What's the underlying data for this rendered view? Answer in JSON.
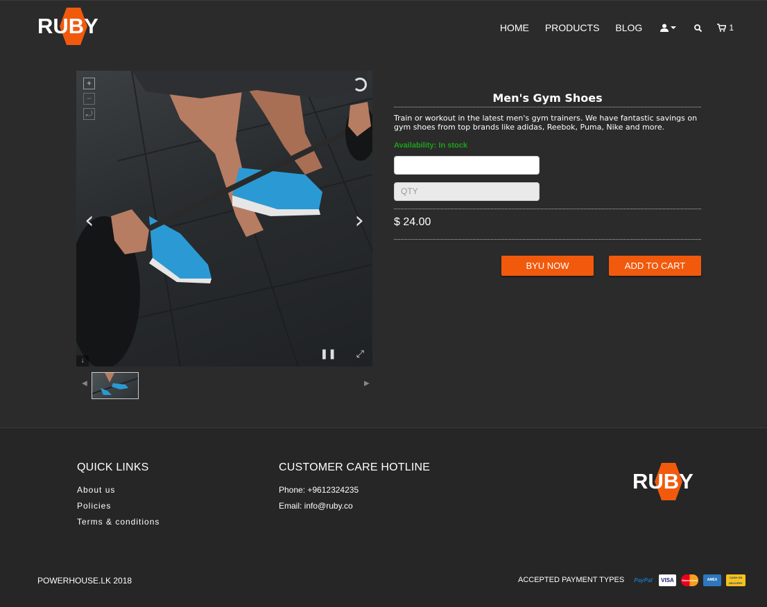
{
  "brand": {
    "name": "RUBY",
    "accent": "#f15a0d"
  },
  "nav": {
    "items": [
      "HOME",
      "PRODUCTS",
      "BLOG"
    ],
    "user_icon": "user-icon",
    "search_icon": "search-icon",
    "cart_icon": "cart-icon",
    "cart_count": "1"
  },
  "product": {
    "title": "Men's Gym Shoes",
    "description": "Train or workout in the latest men's gym trainers. We have fantastic savings on gym shoes from top brands like adidas, Reebok, Puma, Nike and more.",
    "availability": "Availability: In stock",
    "availability_color": "#1aa31a",
    "option_field_value": "",
    "qty_placeholder": "QTY",
    "price": "$ 24.00",
    "buy_now_label": "BYU NOW",
    "add_to_cart_label": "ADD TO CART"
  },
  "viewer": {
    "zoom_in": "+",
    "zoom_out": "−",
    "reset": "⤾",
    "prev": "‹",
    "next": "›",
    "pause": "❚❚",
    "fullscreen": "⤢",
    "download": "↓"
  },
  "footer": {
    "quick_links_title": "QUICK LINKS",
    "links": [
      "About us",
      "Policies",
      "Terms & conditions"
    ],
    "hotline_title": "CUSTOMER CARE HOTLINE",
    "phone": "Phone: +9612324235",
    "email": "Email: info@ruby.co",
    "copyright": "POWERHOUSE.LK 2018",
    "payment_label": "ACCEPTED PAYMENT TYPES",
    "payments": [
      "PayPal",
      "VISA",
      "MasterCard",
      "AMEX",
      "CASH ON DELIVERY"
    ]
  }
}
